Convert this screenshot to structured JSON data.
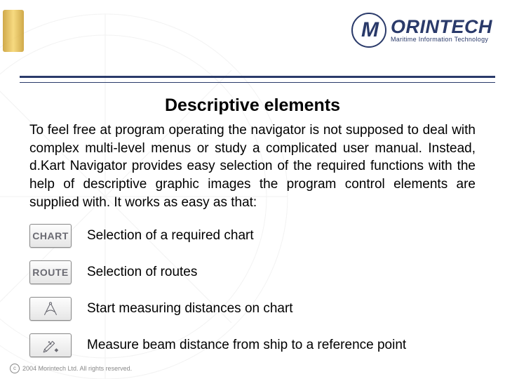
{
  "logo": {
    "mark_letter": "M",
    "name": "ORINTECH",
    "tagline": "Maritime Information Technology"
  },
  "title": "Descriptive elements",
  "body": "To feel free at program operating the navigator is not supposed to deal with complex multi-level menus or study a complicated user manual. Instead, d.Kart Navigator provides easy selection of the required functions with the help of descriptive graphic images the program control elements are supplied with. It works as easy as that:",
  "items": [
    {
      "button": "CHART",
      "icon": "text",
      "label": "Selection of a required chart"
    },
    {
      "button": "ROUTE",
      "icon": "text",
      "label": "Selection of routes"
    },
    {
      "button": "",
      "icon": "compass",
      "label": "Start measuring distances on chart"
    },
    {
      "button": "",
      "icon": "beam",
      "label": "Measure beam distance from ship to a reference point"
    }
  ],
  "footer": "2004 Morintech Ltd. All rights reserved."
}
